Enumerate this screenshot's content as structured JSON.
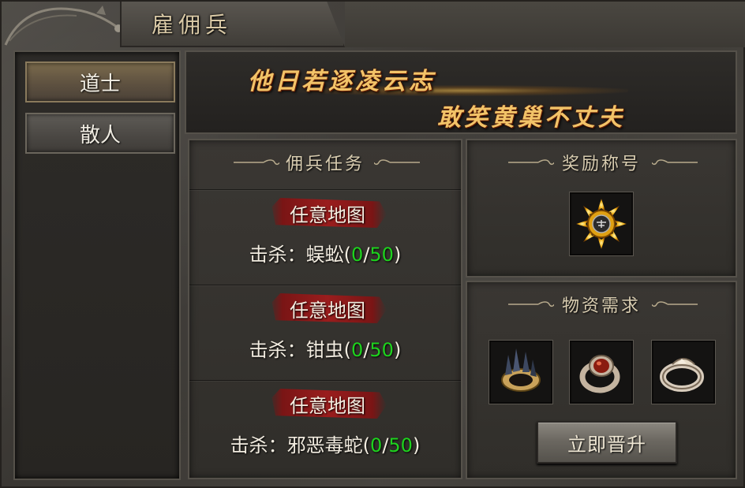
{
  "window": {
    "title": "雇佣兵"
  },
  "sidebar": {
    "items": [
      {
        "label": "道士",
        "active": true
      },
      {
        "label": "散人",
        "active": false
      }
    ]
  },
  "banner": {
    "line1": "他日若逐凌云志",
    "line2": "敢笑黄巢不丈夫"
  },
  "missions": {
    "title": "佣兵任务",
    "items": [
      {
        "map": "任意地图",
        "kill_prefix": "击杀：",
        "target": "蜈蚣",
        "current": "0",
        "total": "50"
      },
      {
        "map": "任意地图",
        "kill_prefix": "击杀：",
        "target": "钳虫",
        "current": "0",
        "total": "50"
      },
      {
        "map": "任意地图",
        "kill_prefix": "击杀：",
        "target": "邪恶毒蛇",
        "current": "0",
        "total": "50"
      }
    ]
  },
  "reward": {
    "title": "奖励称号",
    "icon": "sun-badge-icon"
  },
  "materials": {
    "title": "物资需求",
    "items": [
      {
        "icon": "spiked-bracelet-icon"
      },
      {
        "icon": "ruby-ring-icon"
      },
      {
        "icon": "silver-ring-icon"
      }
    ],
    "upgrade_label": "立即晋升"
  },
  "colors": {
    "accent_green": "#1ed21e",
    "slogan_gold": "#f2c368",
    "map_tag_red": "#9a1d1d"
  }
}
